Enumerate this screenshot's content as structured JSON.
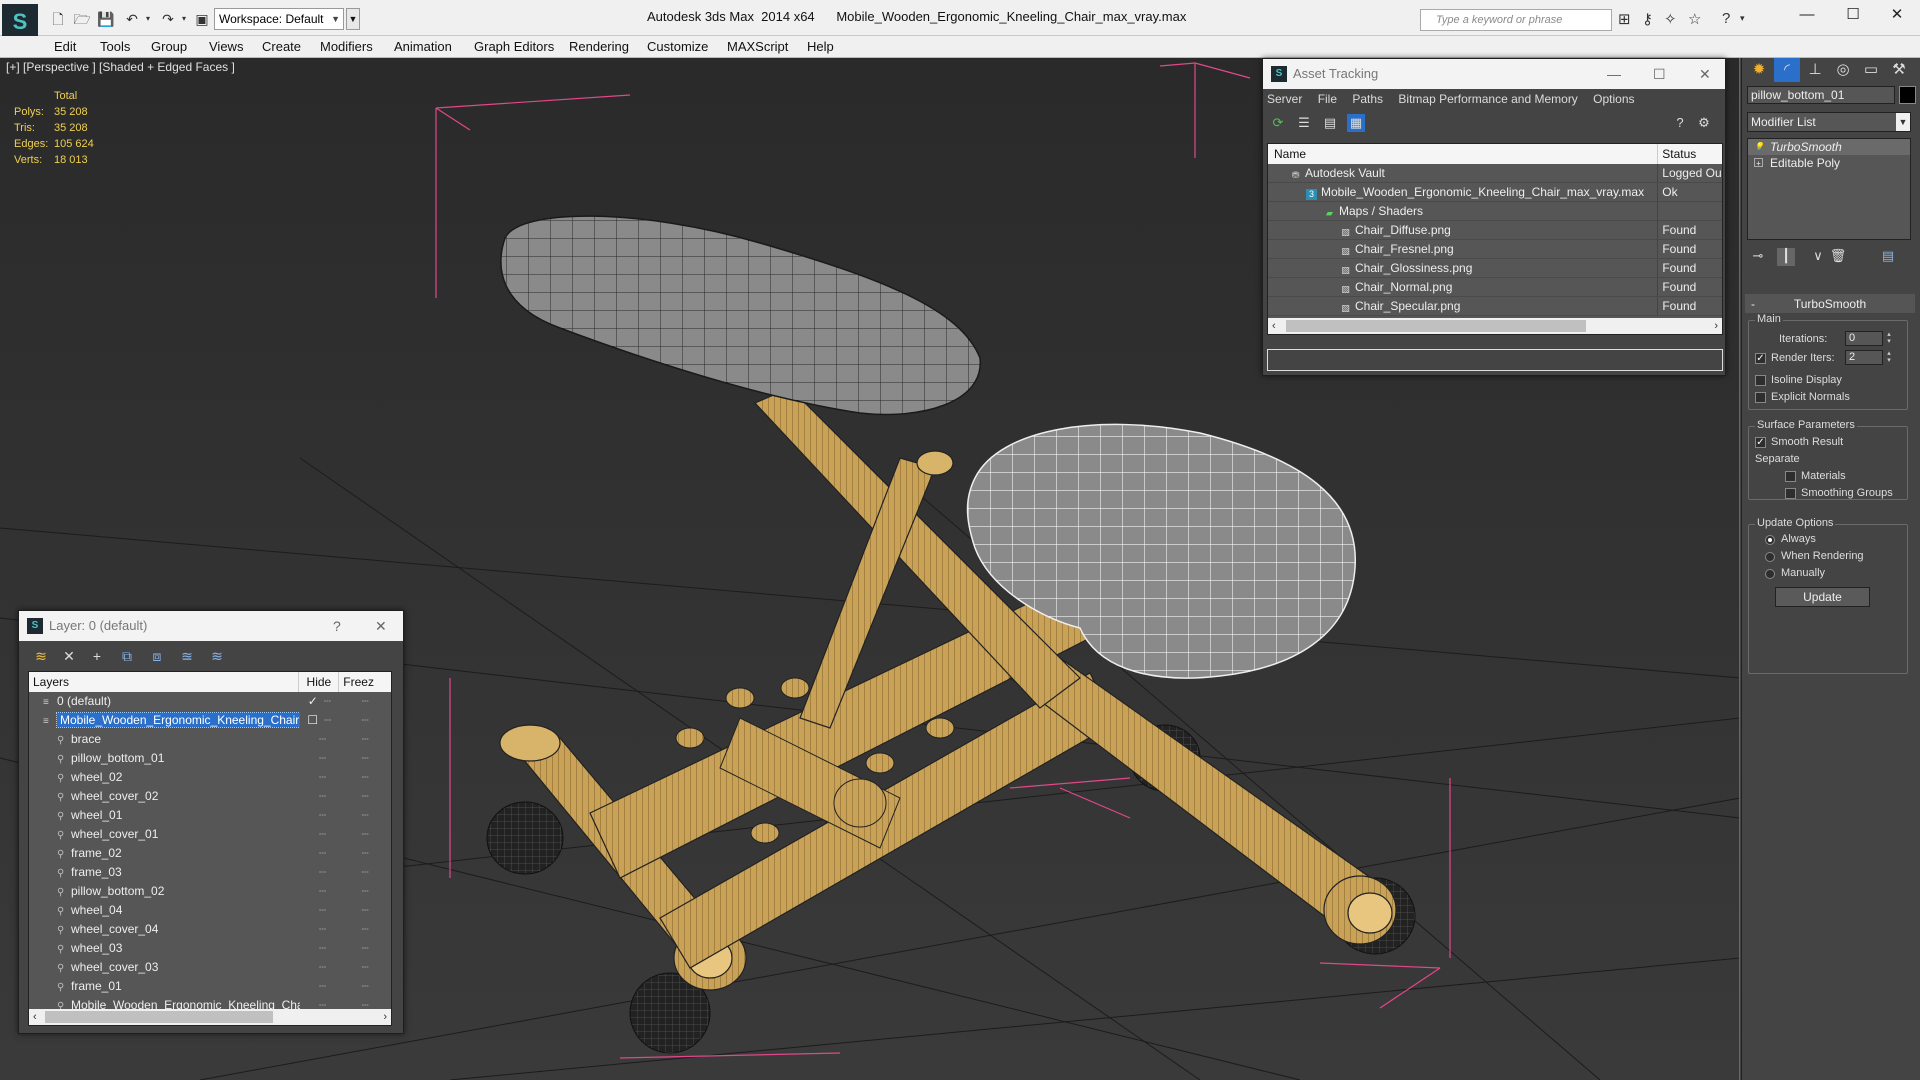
{
  "titlebar": {
    "workspace": "Workspace: Default",
    "window_title": "Autodesk 3ds Max  2014 x64      Mobile_Wooden_Ergonomic_Kneeling_Chair_max_vray.max",
    "search_placeholder": "Type a keyword or phrase",
    "minimize": "—",
    "maximize": "☐",
    "close": "✕"
  },
  "menu": [
    "Edit",
    "Tools",
    "Group",
    "Views",
    "Create",
    "Modifiers",
    "Animation",
    "Graph Editors",
    "Rendering",
    "Customize",
    "MAXScript",
    "Help"
  ],
  "viewport": {
    "label": "[+] [Perspective ] [Shaded + Edged Faces ]",
    "stats_header": "Total",
    "stats": [
      {
        "k": "Polys:",
        "v": "35 208"
      },
      {
        "k": "Tris:",
        "v": "35 208"
      },
      {
        "k": "Edges:",
        "v": "105 624"
      },
      {
        "k": "Verts:",
        "v": "18 013"
      }
    ]
  },
  "asset_tracking": {
    "title": "Asset Tracking",
    "menu": [
      "Server",
      "File",
      "Paths",
      "Bitmap Performance and Memory",
      "Options"
    ],
    "col_name": "Name",
    "col_status": "Status",
    "rows": [
      {
        "name": "Autodesk Vault",
        "status": "Logged Ou",
        "icon": "vault-icon",
        "indent": 1
      },
      {
        "name": "Mobile_Wooden_Ergonomic_Kneeling_Chair_max_vray.max",
        "status": "Ok",
        "icon": "max-file-icon",
        "indent": 2
      },
      {
        "name": "Maps / Shaders",
        "status": "",
        "icon": "maps-icon",
        "indent": 3
      },
      {
        "name": "Chair_Diffuse.png",
        "status": "Found",
        "icon": "bitmap-icon",
        "indent": 4
      },
      {
        "name": "Chair_Fresnel.png",
        "status": "Found",
        "icon": "bitmap-icon",
        "indent": 4
      },
      {
        "name": "Chair_Glossiness.png",
        "status": "Found",
        "icon": "bitmap-icon",
        "indent": 4
      },
      {
        "name": "Chair_Normal.png",
        "status": "Found",
        "icon": "bitmap-icon",
        "indent": 4
      },
      {
        "name": "Chair_Specular.png",
        "status": "Found",
        "icon": "bitmap-icon",
        "indent": 4
      }
    ]
  },
  "layer_window": {
    "title": "Layer: 0 (default)",
    "help": "?",
    "close": "✕",
    "col_layers": "Layers",
    "col_hide": "Hide",
    "col_freeze": "Freez",
    "rows": [
      {
        "name": "0 (default)",
        "indent": 1,
        "type": "layer",
        "selected": false,
        "check": "✓"
      },
      {
        "name": "Mobile_Wooden_Ergonomic_Kneeling_Chair",
        "indent": 1,
        "type": "layer",
        "selected": true,
        "check": "☐"
      },
      {
        "name": "brace",
        "indent": 2,
        "type": "object",
        "selected": false,
        "check": ""
      },
      {
        "name": "pillow_bottom_01",
        "indent": 2,
        "type": "object",
        "selected": false,
        "check": ""
      },
      {
        "name": "wheel_02",
        "indent": 2,
        "type": "object",
        "selected": false,
        "check": ""
      },
      {
        "name": "wheel_cover_02",
        "indent": 2,
        "type": "object",
        "selected": false,
        "check": ""
      },
      {
        "name": "wheel_01",
        "indent": 2,
        "type": "object",
        "selected": false,
        "check": ""
      },
      {
        "name": "wheel_cover_01",
        "indent": 2,
        "type": "object",
        "selected": false,
        "check": ""
      },
      {
        "name": "frame_02",
        "indent": 2,
        "type": "object",
        "selected": false,
        "check": ""
      },
      {
        "name": "frame_03",
        "indent": 2,
        "type": "object",
        "selected": false,
        "check": ""
      },
      {
        "name": "pillow_bottom_02",
        "indent": 2,
        "type": "object",
        "selected": false,
        "check": ""
      },
      {
        "name": "wheel_04",
        "indent": 2,
        "type": "object",
        "selected": false,
        "check": ""
      },
      {
        "name": "wheel_cover_04",
        "indent": 2,
        "type": "object",
        "selected": false,
        "check": ""
      },
      {
        "name": "wheel_03",
        "indent": 2,
        "type": "object",
        "selected": false,
        "check": ""
      },
      {
        "name": "wheel_cover_03",
        "indent": 2,
        "type": "object",
        "selected": false,
        "check": ""
      },
      {
        "name": "frame_01",
        "indent": 2,
        "type": "object",
        "selected": false,
        "check": ""
      },
      {
        "name": "Mobile_Wooden_Ergonomic_Kneeling_Chair",
        "indent": 2,
        "type": "object",
        "selected": false,
        "check": ""
      }
    ]
  },
  "command_panel": {
    "object_name": "pillow_bottom_01",
    "modifier_list": "Modifier List",
    "stack": [
      {
        "name": "TurboSmooth",
        "active": true,
        "icon": "bulb-icon"
      },
      {
        "name": "Editable Poly",
        "active": false,
        "icon": "poly-icon"
      }
    ],
    "turbosmooth": {
      "title": "TurboSmooth",
      "main_label": "Main",
      "iterations_label": "Iterations:",
      "iterations_value": "0",
      "render_iters_label": "Render Iters:",
      "render_iters_value": "2",
      "render_iters_checked": true,
      "isoline_label": "Isoline Display",
      "explicit_label": "Explicit Normals",
      "surface_label": "Surface Parameters",
      "smooth_result_label": "Smooth Result",
      "separate_label": "Separate",
      "materials_label": "Materials",
      "smoothing_groups_label": "Smoothing Groups",
      "update_options_label": "Update Options",
      "always_label": "Always",
      "when_rendering_label": "When Rendering",
      "manually_label": "Manually",
      "update_button": "Update"
    }
  },
  "colors": {
    "selection": "#2a6fc9",
    "stats": "#f0d050",
    "wood": "#c9a257",
    "cushion": "#8c8c8c",
    "bbox": "#e0488a"
  }
}
